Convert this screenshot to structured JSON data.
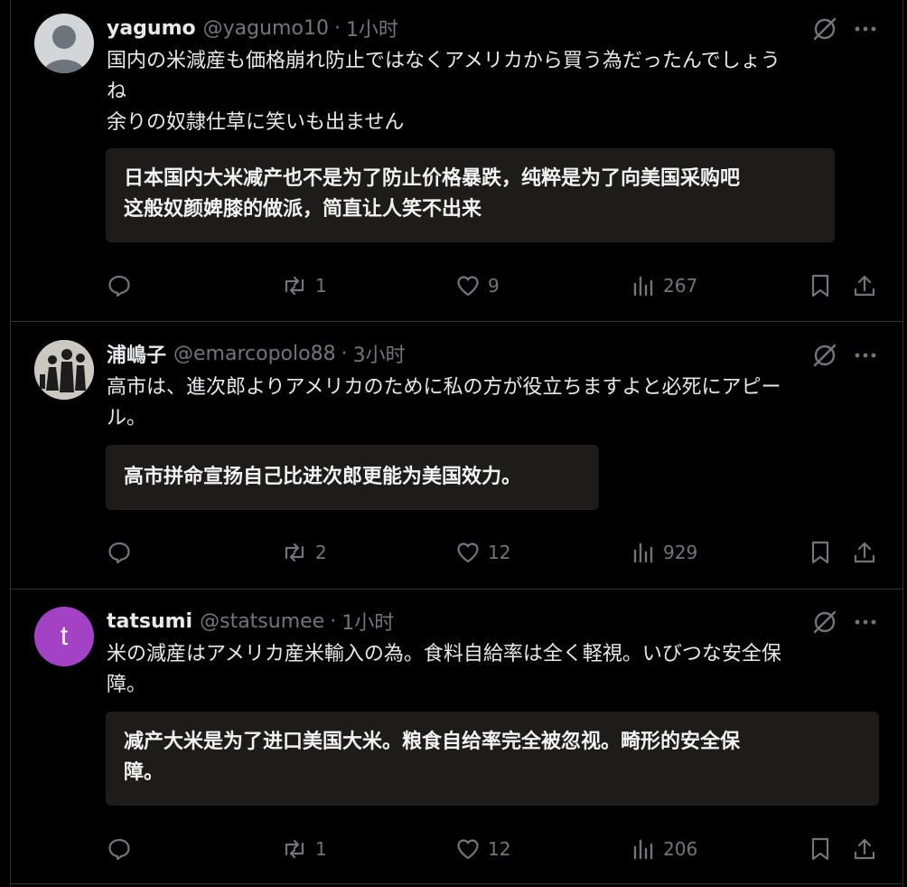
{
  "posts": [
    {
      "name": "yagumo",
      "handle": "@yagumo10",
      "dot": "·",
      "time": "1小时",
      "text": "国内の米減産も価格崩れ防止ではなくアメリカから買う為だったんでしょうね\n余りの奴隷仕草に笑いも出ません",
      "translation": "日本国内大米减产也不是为了防止价格暴跌，纯粹是为了向美国采购吧\n这般奴颜婢膝的做派，简直让人笑不出来",
      "replies": "",
      "reposts": "1",
      "likes": "9",
      "views": "267",
      "avatar_type": "default-person"
    },
    {
      "name": "浦嶋子",
      "handle": "@emarcopolo88",
      "dot": "·",
      "time": "3小时",
      "text": "高市は、進次郎よりアメリカのために私の方が役立ちますよと必死にアピール。",
      "translation": "高市拼命宣扬自己比进次郎更能为美国效力。",
      "replies": "",
      "reposts": "2",
      "likes": "12",
      "views": "929",
      "avatar_type": "silhouette-figures"
    },
    {
      "name": "tatsumi",
      "handle": "@statsumee",
      "dot": "·",
      "time": "1小时",
      "text": "米の減産はアメリカ産米輸入の為。食料自給率は全く軽視。いびつな安全保障。",
      "translation": "减产大米是为了进口美国大米。粮食自给率完全被忽视。畸形的安全保障。",
      "replies": "",
      "reposts": "1",
      "likes": "12",
      "views": "206",
      "avatar_type": "letter",
      "avatar_letter": "t",
      "avatar_color": "#a442c6"
    }
  ],
  "icons": {
    "grok": "grok-slash-circle-icon",
    "more": "more-dots-icon",
    "reply": "reply-bubble-icon",
    "repost": "repost-arrows-icon",
    "like": "heart-icon",
    "views": "views-bars-icon",
    "bookmark": "bookmark-icon",
    "share": "share-upload-icon"
  },
  "colors": {
    "background": "#000000",
    "text": "#e7e9ea",
    "muted": "#71767b",
    "translation_bg": "#1e1b1b",
    "avatar_tatsumi": "#a442c6"
  }
}
